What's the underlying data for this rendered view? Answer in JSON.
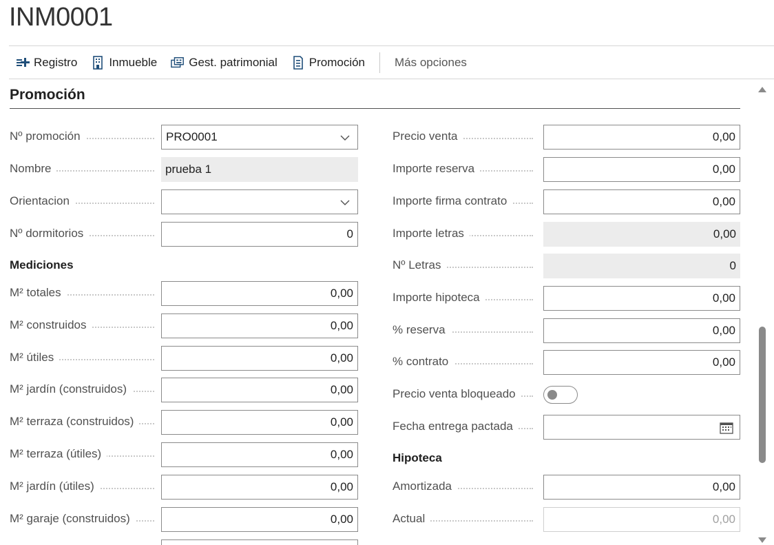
{
  "page": {
    "title": "INM0001"
  },
  "actions": {
    "registro": "Registro",
    "inmueble": "Inmueble",
    "gest_patrimonial": "Gest. patrimonial",
    "promocion": "Promoción",
    "mas_opciones": "Más opciones"
  },
  "section": {
    "title": "Promoción"
  },
  "left": {
    "n_promocion": {
      "label": "Nº promoción",
      "value": "PRO0001"
    },
    "nombre": {
      "label": "Nombre",
      "value": "prueba 1"
    },
    "orientacion": {
      "label": "Orientacion",
      "value": ""
    },
    "n_dormitorios": {
      "label": "Nº dormitorios",
      "value": "0"
    },
    "mediciones_title": "Mediciones",
    "m2_totales": {
      "label": "M² totales",
      "value": "0,00"
    },
    "m2_construidos": {
      "label": "M² construidos",
      "value": "0,00"
    },
    "m2_utiles": {
      "label": "M² útiles",
      "value": "0,00"
    },
    "m2_jardin_construidos": {
      "label": "M² jardín (construidos)",
      "value": "0,00"
    },
    "m2_terraza_construidos": {
      "label": "M² terraza (construidos)",
      "value": "0,00"
    },
    "m2_terraza_utiles": {
      "label": "M² terraza (útiles)",
      "value": "0,00"
    },
    "m2_jardin_utiles": {
      "label": "M² jardín (útiles)",
      "value": "0,00"
    },
    "m2_garaje_construidos": {
      "label": "M² garaje (construidos)",
      "value": "0,00"
    }
  },
  "right": {
    "precio_venta": {
      "label": "Precio venta",
      "value": "0,00"
    },
    "importe_reserva": {
      "label": "Importe reserva",
      "value": "0,00"
    },
    "importe_firma_contrato": {
      "label": "Importe firma contrato",
      "value": "0,00"
    },
    "importe_letras": {
      "label": "Importe letras",
      "value": "0,00"
    },
    "n_letras": {
      "label": "Nº Letras",
      "value": "0"
    },
    "importe_hipoteca": {
      "label": "Importe hipoteca",
      "value": "0,00"
    },
    "pct_reserva": {
      "label": "% reserva",
      "value": "0,00"
    },
    "pct_contrato": {
      "label": "% contrato",
      "value": "0,00"
    },
    "precio_venta_bloqueado": {
      "label": "Precio venta bloqueado",
      "value": false
    },
    "fecha_entrega_pactada": {
      "label": "Fecha entrega pactada",
      "value": ""
    },
    "hipoteca_title": "Hipoteca",
    "amortizada": {
      "label": "Amortizada",
      "value": "0,00"
    },
    "actual": {
      "label": "Actual",
      "value": "0,00"
    }
  },
  "icons": {
    "registro": "add-list-icon",
    "inmueble": "building-icon",
    "gest_patrimonial": "assets-icon",
    "promocion": "document-icon",
    "orientacion_chevron": "chevron-down-icon",
    "calendar": "calendar-icon"
  },
  "colors": {
    "accent": "#0f6cbd",
    "border": "#8a8a8a",
    "readonly_bg": "#ececec"
  }
}
